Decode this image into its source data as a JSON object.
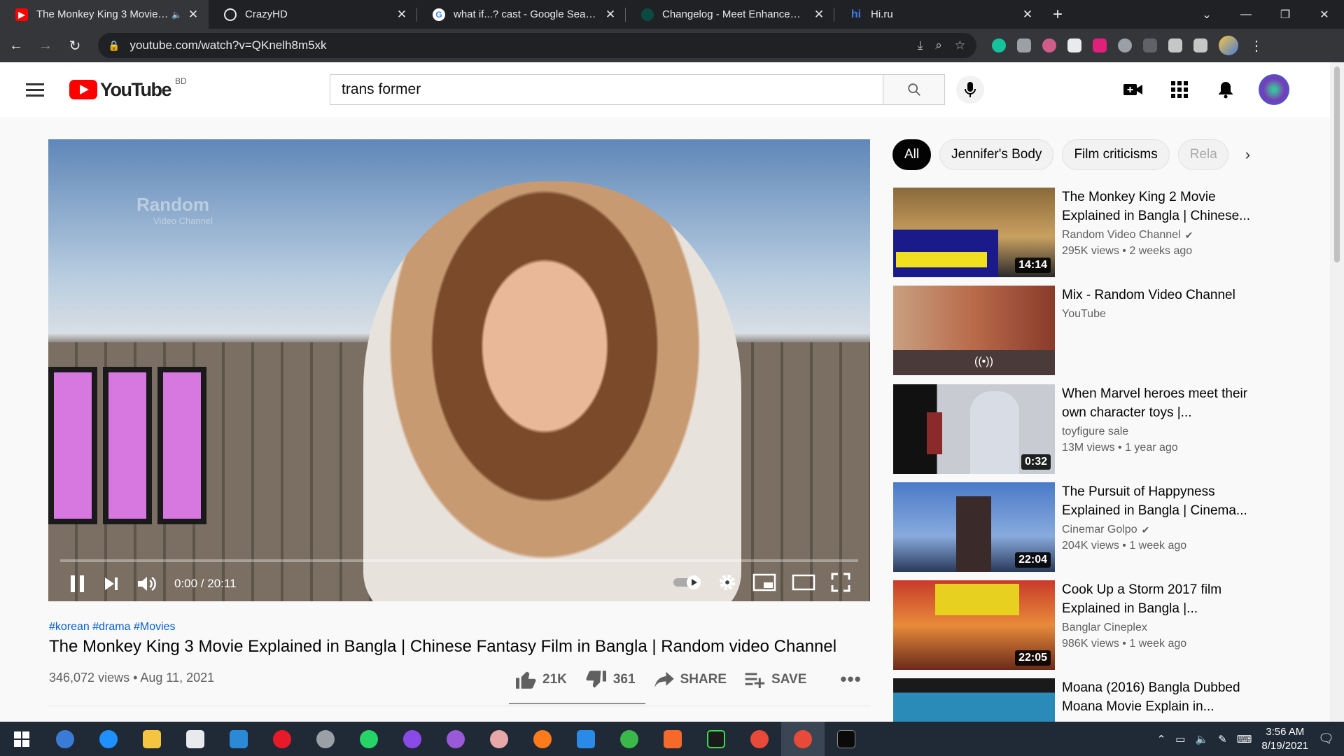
{
  "browser": {
    "tabs": [
      {
        "title": "The Monkey King 3 Movie Ex",
        "favicon": "youtube-icon",
        "active": true,
        "audio": true
      },
      {
        "title": "CrazyHD",
        "favicon": "globe-icon"
      },
      {
        "title": "what if...? cast - Google Search",
        "favicon": "google-icon"
      },
      {
        "title": "Changelog - Meet Enhancement",
        "favicon": "meet-icon"
      },
      {
        "title": "Hi.ru",
        "favicon": "hi-icon"
      }
    ],
    "url": "youtube.com/watch?v=QKnelh8m5xk"
  },
  "youtube": {
    "logo_text": "YouTube",
    "region": "BD",
    "search_value": "trans former"
  },
  "player": {
    "watermark": "Random",
    "watermark_sub": "Video Channel",
    "time": "0:00 / 20:11",
    "progress": 0
  },
  "video": {
    "hashtags": "#korean #drama #Movies",
    "title": "The Monkey King 3 Movie Explained in Bangla | Chinese Fantasy Film in Bangla | Random video Channel",
    "views_date": "346,072 views • Aug 11, 2021",
    "likes": "21K",
    "dislikes": "361",
    "share_label": "SHARE",
    "save_label": "SAVE"
  },
  "chips": [
    "All",
    "Jennifer's Body",
    "Film criticisms",
    "Rela"
  ],
  "recommendations": [
    {
      "title": "The Monkey King 2 Movie Explained in Bangla | Chinese...",
      "channel": "Random Video Channel",
      "verified": true,
      "meta": "295K views • 2 weeks ago",
      "duration": "14:14",
      "thumb_color": "#8a6a3a"
    },
    {
      "title": "Mix - Random Video Channel",
      "channel": "YouTube",
      "verified": false,
      "meta": "",
      "duration": "",
      "thumb_color": "#b86a4a"
    },
    {
      "title": "When Marvel heroes meet their own character toys |...",
      "channel": "toyfigure sale",
      "verified": false,
      "meta": "13M views • 1 year ago",
      "duration": "0:32",
      "thumb_color": "#8a8f96"
    },
    {
      "title": "The Pursuit of Happyness Explained in Bangla | Cinema...",
      "channel": "Cinemar Golpo",
      "verified": true,
      "meta": "204K views • 1 week ago",
      "duration": "22:04",
      "thumb_color": "#3a6aa8"
    },
    {
      "title": "Cook Up a Storm 2017 film Explained in Bangla |...",
      "channel": "Banglar Cineplex",
      "verified": false,
      "meta": "986K views • 1 week ago",
      "duration": "22:05",
      "thumb_color": "#c83a2a"
    },
    {
      "title": "Moana (2016) Bangla Dubbed | Moana Movie Explain in...",
      "channel": "",
      "verified": false,
      "meta": "",
      "duration": "",
      "thumb_color": "#2a8ab8"
    }
  ],
  "taskbar": {
    "time": "3:56 AM",
    "date": "8/19/2021"
  }
}
